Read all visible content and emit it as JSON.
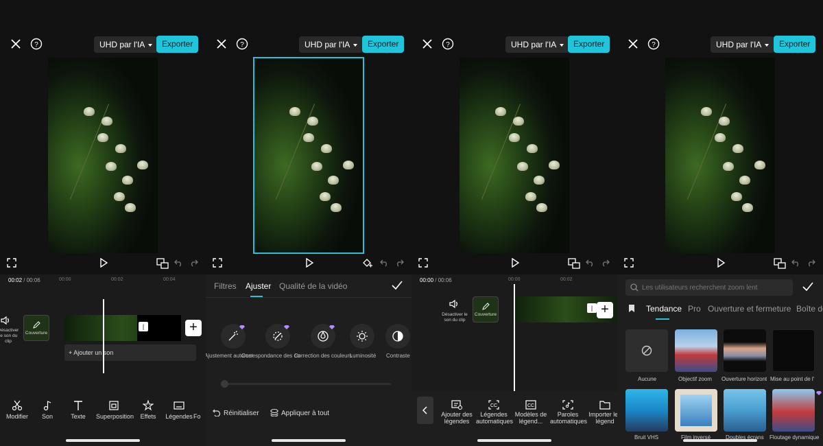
{
  "common": {
    "uhd_label": "UHD par l'IA",
    "export_label": "Exporter",
    "time_current_1": "00:02",
    "time_total": "00:06",
    "time_current_3": "00:00",
    "ticks": [
      "00:00",
      "00:02",
      "00:04"
    ],
    "ticks_3": [
      "00:00",
      "00:02"
    ]
  },
  "panel1": {
    "mute_label": "Désactiver le son du clip",
    "cover_label": "Couverture",
    "add_sound": "+ Ajouter un son",
    "tools": [
      "Modifier",
      "Son",
      "Texte",
      "Superposition",
      "Effets",
      "Légendes",
      "Fo"
    ]
  },
  "panel2": {
    "tabs": [
      "Filtres",
      "Ajuster",
      "Qualité de la vidéo"
    ],
    "adjust_items": [
      "Ajustement automatique",
      "Correspondance des couleurs",
      "Correction des couleurs",
      "Luminosité",
      "Contraste"
    ],
    "reset_label": "Réinitialiser",
    "apply_all_label": "Appliquer à tout"
  },
  "panel3": {
    "mute_label": "Désactiver le son du clip",
    "cover_label": "Couverture",
    "tools": [
      "Ajouter des légendes",
      "Légendes automatiques",
      "Modèles de légend...",
      "Paroles automatiques",
      "Importer les légend"
    ]
  },
  "panel4": {
    "search_placeholder": "Les utilisateurs recherchent zoom lent",
    "tabs": [
      "Tendance",
      "Pro",
      "Ouverture et fermeture",
      "Boîte de"
    ],
    "effects_row1": [
      "Aucune",
      "Objectif zoom",
      "Ouverture horizontale",
      "Mise au point de l'"
    ],
    "effects_row2": [
      "Bruit VHS",
      "Film inversé",
      "Doubles écrans",
      "Floutage dynamique"
    ]
  },
  "colors": {
    "accent": "#1fc6db",
    "premium": "#b38cff",
    "bg": "#121212"
  }
}
